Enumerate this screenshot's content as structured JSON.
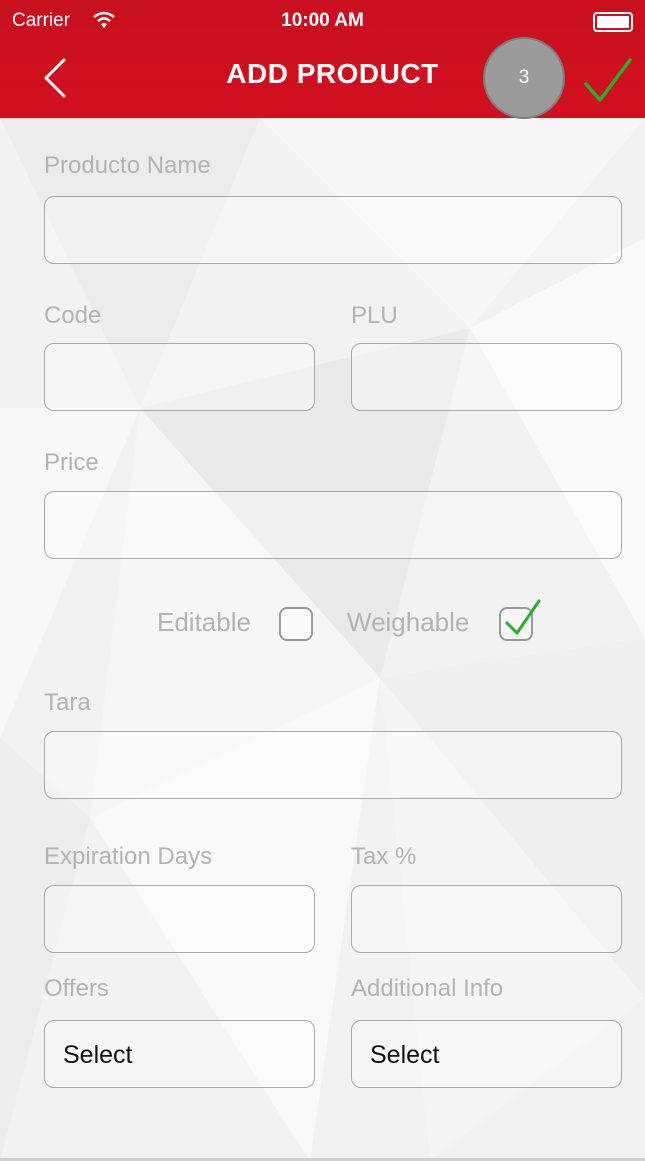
{
  "status": {
    "carrier": "Carrier",
    "time": "10:00 AM"
  },
  "nav": {
    "title": "ADD PRODUCT",
    "badge": "3"
  },
  "form": {
    "product_name": {
      "label": "Producto Name",
      "value": ""
    },
    "code": {
      "label": "Code",
      "value": ""
    },
    "plu": {
      "label": "PLU",
      "value": ""
    },
    "price": {
      "label": "Price",
      "value": ""
    },
    "editable": {
      "label": "Editable",
      "checked": false
    },
    "weighable": {
      "label": "Weighable",
      "checked": true
    },
    "tara": {
      "label": "Tara",
      "value": ""
    },
    "expiration_days": {
      "label": "Expiration Days",
      "value": ""
    },
    "tax": {
      "label": "Tax %",
      "value": ""
    },
    "offers": {
      "label": "Offers",
      "value": "Select"
    },
    "additional_info": {
      "label": "Additional Info",
      "value": "Select"
    }
  },
  "colors": {
    "header": "#d20f1f",
    "accent_check": "#22b22a"
  }
}
